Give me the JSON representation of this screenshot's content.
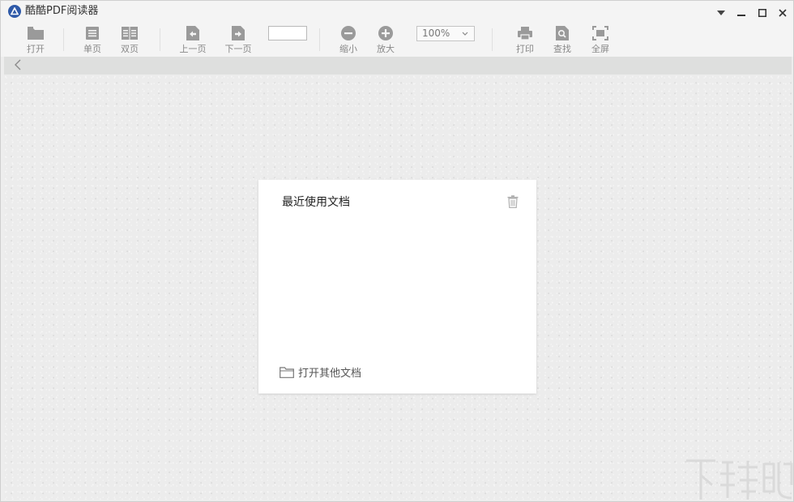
{
  "app": {
    "title": "酷酷PDF阅读器"
  },
  "window_controls": {
    "menu": "▼",
    "minimize": "—",
    "maximize": "□",
    "close": "✕"
  },
  "toolbar": {
    "open": "打开",
    "single_page": "单页",
    "double_page": "双页",
    "prev_page": "上一页",
    "next_page": "下一页",
    "page_input_value": "",
    "zoom_out": "缩小",
    "zoom_in": "放大",
    "zoom_value": "100%",
    "print": "打印",
    "find": "查找",
    "fullscreen": "全屏"
  },
  "recent": {
    "title": "最近使用文档",
    "files": [],
    "open_other": "打开其他文档"
  },
  "watermark": {
    "text": "下载吧"
  },
  "colors": {
    "logo": "#2f5aa8",
    "icon": "#9a9a9a",
    "canvas": "#ececec",
    "panel": "#ffffff"
  }
}
